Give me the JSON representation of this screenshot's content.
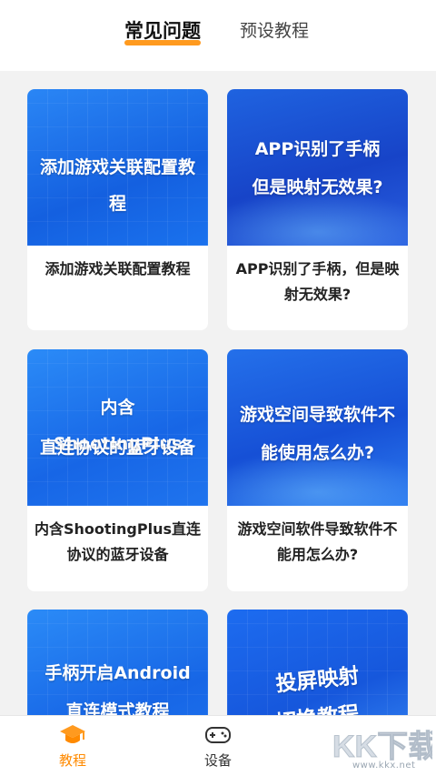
{
  "header": {
    "tabs": [
      {
        "label": "常见问题",
        "active": true
      },
      {
        "label": "预设教程",
        "active": false
      }
    ]
  },
  "cards": [
    {
      "thumb_lines": [
        "添加游戏关联配置教程"
      ],
      "caption": "添加游戏关联配置教程"
    },
    {
      "thumb_lines": [
        "APP识别了手柄",
        "但是映射无效果?"
      ],
      "caption": "APP识别了手柄，但是映射无效果?"
    },
    {
      "thumb_lines": [
        "内含ShootingPlus",
        "直连协议的蓝牙设备"
      ],
      "caption": "内含ShootingPlus直连协议的蓝牙设备"
    },
    {
      "thumb_lines": [
        "游戏空间导致软件不",
        "能使用怎么办?"
      ],
      "caption": "游戏空间软件导致软件不能用怎么办?"
    },
    {
      "thumb_lines": [
        "手柄开启Android",
        "直连模式教程"
      ],
      "caption": ""
    },
    {
      "thumb_lines": [
        "投屏映射",
        "切换教程"
      ],
      "caption": ""
    }
  ],
  "bottom_nav": {
    "items": [
      {
        "label": "教程",
        "icon": "graduation-cap-icon",
        "active": true
      },
      {
        "label": "设备",
        "icon": "gamepad-icon",
        "active": false
      }
    ]
  },
  "watermark": {
    "text": "www.kkx.net"
  },
  "colors": {
    "accent": "#ff9a1f",
    "active_nav": "#ff8a00",
    "thumb_blue": "#1a6fe8"
  }
}
